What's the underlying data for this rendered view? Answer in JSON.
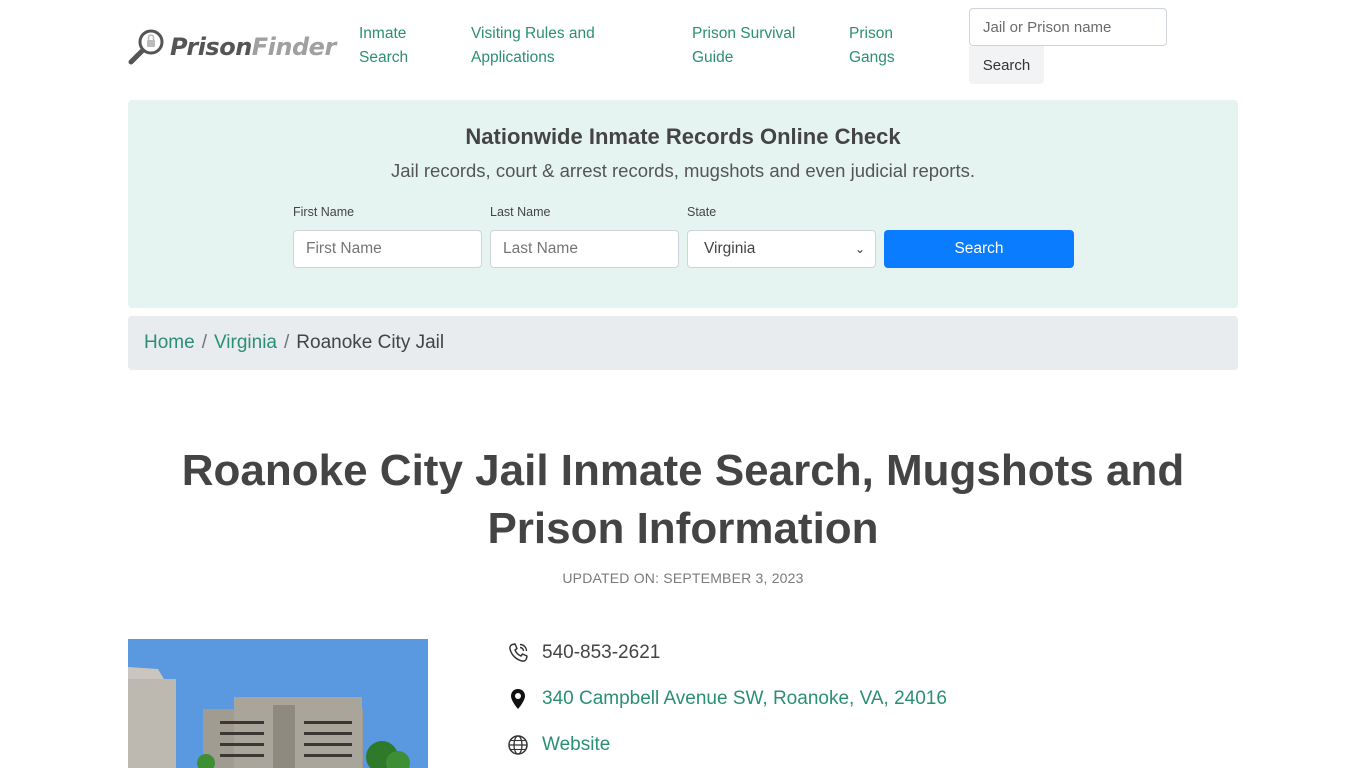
{
  "header": {
    "logo_part1": "Prison",
    "logo_part2": "Finder",
    "nav": [
      {
        "label": "Inmate Search"
      },
      {
        "label": "Visiting Rules and Applications"
      },
      {
        "label": "Prison Survival Guide"
      },
      {
        "label": "Prison Gangs"
      }
    ],
    "search_placeholder": "Jail or Prison name",
    "search_button": "Search"
  },
  "promo": {
    "title": "Nationwide Inmate Records Online Check",
    "subtitle": "Jail records, court & arrest records, mugshots and even judicial reports.",
    "first_name_label": "First Name",
    "first_name_placeholder": "First Name",
    "last_name_label": "Last Name",
    "last_name_placeholder": "Last Name",
    "state_label": "State",
    "state_value": "Virginia",
    "search_button": "Search"
  },
  "breadcrumb": {
    "home": "Home",
    "state": "Virginia",
    "current": "Roanoke City Jail",
    "separator": "/"
  },
  "page": {
    "title": "Roanoke City Jail Inmate Search, Mugshots and Prison Information",
    "updated": "UPDATED ON: SEPTEMBER 3, 2023"
  },
  "contact": {
    "phone": "540-853-2621",
    "address": "340 Campbell Avenue SW, Roanoke, VA, 24016",
    "website": "Website"
  },
  "colors": {
    "accent_green": "#2a8f73",
    "promo_bg": "#e6f4f1",
    "primary_button": "#0a7cff",
    "breadcrumb_bg": "#e9ecef"
  }
}
